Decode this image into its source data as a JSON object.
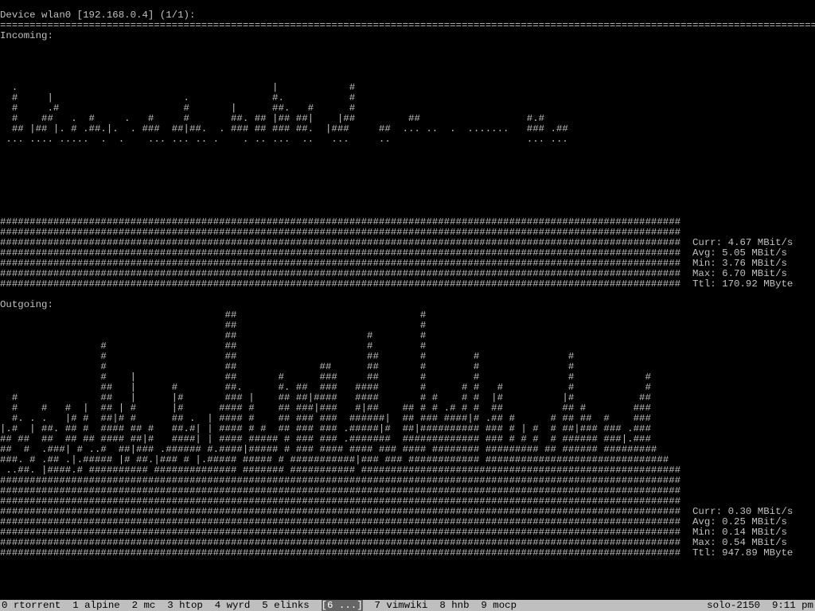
{
  "header": {
    "device_line": "Device wlan0 [192.168.0.4] (1/1):",
    "rule": "============================================================================================================================================"
  },
  "incoming": {
    "label": "Incoming:",
    "graph": [
      "                                                                                                                      ",
      "                                                                                                                      ",
      "                                                                                                                      ",
      "                                                                                                                      ",
      "  .                                           |            #                                                          ",
      "  #     |                      .              #.           #                                                          ",
      "  #     .#                     #       |      ##.   #      #                                                          ",
      "  #    ##   .  #     .   #     #       ##. ## |## ##|    |##         ##                  #.#                          ",
      "  ## |## |. # .##.|.  . ###  ##|##.  . ### ## ### ##.  |###     ##  ... ..  .  .......   ### .##                      ",
      " ... .... .....  .  .    ... ... .. .    . .. ...  ..   ...     ..                       ... ...                      ",
      "                                                                                                                      ",
      "                                                                                                                      ",
      "                                                                                                                      ",
      "                                                                                                                      ",
      "                                                                                                                      ",
      "                                                                                                                      ",
      "                                                                                                                      ",
      "###################################################################################################################",
      "###################################################################################################################",
      "###################################################################################################################",
      "###################################################################################################################",
      "###################################################################################################################",
      "###################################################################################################################",
      "###################################################################################################################"
    ],
    "stats": {
      "curr": "Curr: 4.67 MBit/s",
      "avg": "Avg: 5.05 MBit/s",
      "min": "Min: 3.76 MBit/s",
      "max": "Max: 6.70 MBit/s",
      "ttl": "Ttl: 170.92 MByte"
    }
  },
  "outgoing": {
    "label": "Outgoing:",
    "graph": [
      "                                      ##                               #                                           ",
      "                                      ##                               #                                           ",
      "                                      ##                      #        #                                           ",
      "                 #                    ##                      #        #                                           ",
      "                 #                    ##                      ##       #        #               #                  ",
      "                 #                    ##              ##      ##       #        #               #                  ",
      "                 #    |               ##       #      ###     ##       #        #               #            #     ",
      "                 ##   |      #        ##.      #. ##  ###   ####       #      # #   #           #            #     ",
      "  #              ##   |      |#       ### |    ## ##|####   ####       # #    # #  |#          |#           ##     ",
      "  #    #   #  |  ## | #      |#      #### #    ## ###|###   #|##    ## # # .# # #  ##          ## #        ###     ",
      "  #. . .   |# #  ##|# #      ## .  | #### #    ## ### ###  ######|  ## ### ####|# .## #      # ## ##  #    ###     ",
      "|.#  | ##. ## #  #### ## #   ##.#| | #### # #  ## ### ### .#####|#  ##|########## ### # | #  # ##|### ### .###     ",
      "## ##  ##  ## ## #### ##|#   ####| | #### ##### # ### ### .#######  ############# ### # # #  # ###### ###|.###     ",
      "##  #  .###| # ..#  ##|### .###### #.####|##### # ### #### #### ### #### ######## ######### ## ###### #########    ",
      "###. # .## .|.##### |# ##.|### # |.##### ##### # ###########|### ### ############ ###############################  ",
      " ..##. |####.# ########## ############## ####### ########### ######################################################",
      "###################################################################################################################",
      "###################################################################################################################",
      "###################################################################################################################",
      "###################################################################################################################",
      "###################################################################################################################",
      "###################################################################################################################",
      "###################################################################################################################",
      "###################################################################################################################"
    ],
    "stats": {
      "curr": "Curr: 0.30 MBit/s",
      "avg": "Avg: 0.25 MBit/s",
      "min": "Min: 0.14 MBit/s",
      "max": "Max: 0.54 MBit/s",
      "ttl": "Ttl: 947.89 MByte"
    }
  },
  "statusbar": {
    "tabs": [
      "0 rtorrent",
      "1 alpine",
      "2 mc",
      "3 htop",
      "4 wyrd",
      "5 elinks",
      "[6 ...]",
      "7 vimwiki",
      "8 hnb",
      "9 mocp"
    ],
    "selected_index": 6,
    "host": "solo-2150",
    "time": "9:11 pm"
  },
  "chart_data": [
    {
      "type": "area",
      "title": "Incoming",
      "ylabel": "MBit/s",
      "series": [
        {
          "name": "incoming",
          "curr": 4.67,
          "avg": 5.05,
          "min": 3.76,
          "max": 6.7
        }
      ],
      "total_label": "170.92 MByte"
    },
    {
      "type": "area",
      "title": "Outgoing",
      "ylabel": "MBit/s",
      "series": [
        {
          "name": "outgoing",
          "curr": 0.3,
          "avg": 0.25,
          "min": 0.14,
          "max": 0.54
        }
      ],
      "total_label": "947.89 MByte"
    }
  ]
}
